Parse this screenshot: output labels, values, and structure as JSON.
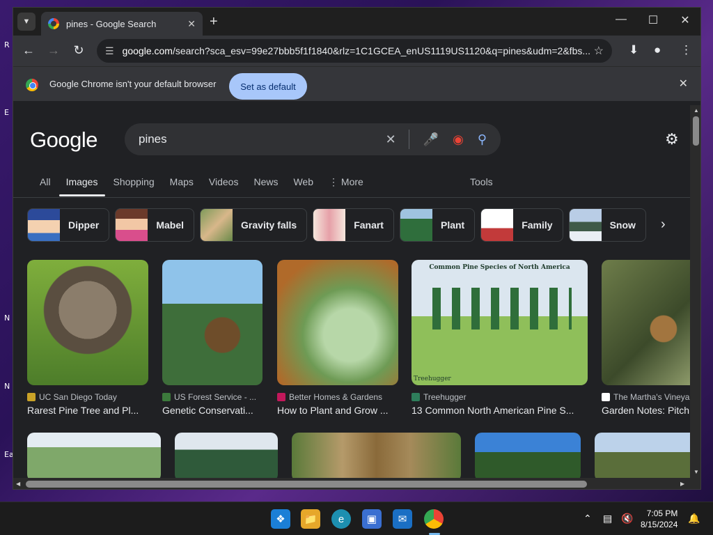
{
  "window": {
    "tab_title": "pines - Google Search",
    "url_prefix": "google.com",
    "url_rest": "/search?sca_esv=99e27bbb5f1f1840&rlz=1C1GCEA_enUS1119US1120&q=pines&udm=2&fbs..."
  },
  "infobar": {
    "message": "Google Chrome isn't your default browser",
    "button": "Set as default"
  },
  "search": {
    "logo": "Google",
    "query": "pines"
  },
  "tabs": [
    "All",
    "Images",
    "Shopping",
    "Maps",
    "Videos",
    "News",
    "Web",
    "More"
  ],
  "tools_label": "Tools",
  "chips": [
    "Dipper",
    "Mabel",
    "Gravity falls",
    "Fanart",
    "Plant",
    "Family",
    "Snow"
  ],
  "results": [
    {
      "source": "UC San Diego Today",
      "title": "Rarest Pine Tree and Pl..."
    },
    {
      "source": "US Forest Service - ...",
      "title": "Genetic Conservati..."
    },
    {
      "source": "Better Homes & Gardens",
      "title": "How to Plant and Grow ..."
    },
    {
      "source": "Treehugger",
      "title": "13 Common North American Pine S...",
      "image_heading": "Common Pine Species of North America",
      "watermark": "Treehugger"
    },
    {
      "source": "The Martha's Vineya",
      "title": "Garden Notes: Pitch"
    }
  ],
  "taskbar": {
    "time": "7:05 PM",
    "date": "8/15/2024"
  },
  "colors": {
    "accent": "#a8c7fa",
    "page_bg": "#202124",
    "chrome_bg": "#35363a"
  }
}
